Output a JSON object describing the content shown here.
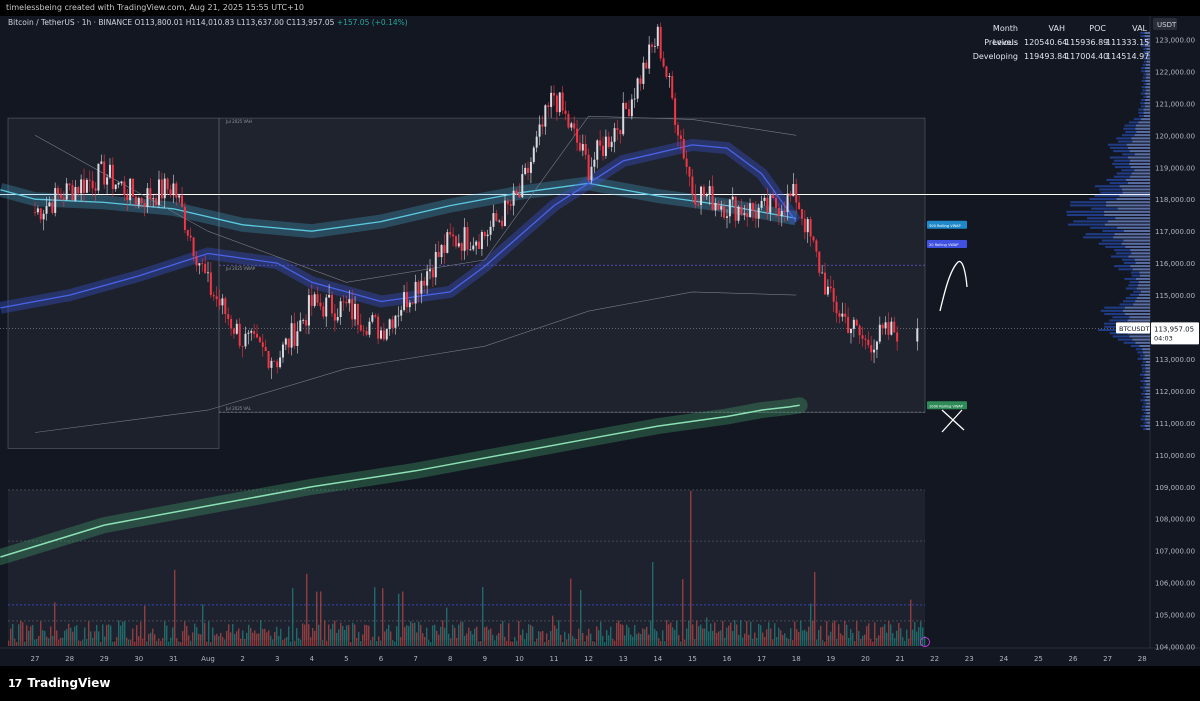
{
  "header": {
    "caption": "timelessbeing created with TradingView.com, Aug 21, 2025 15:55 UTC+10"
  },
  "instrument": {
    "title": "Bitcoin / TetherUS · 1h · BINANCE",
    "open": "O113,800.01",
    "high": "H114,010.83",
    "low": "L113,637.00",
    "close": "C113,957.05",
    "change": "+157.05 (+0.14%)"
  },
  "month_levels": {
    "headers": [
      "Month Levels",
      "VAH",
      "POC",
      "VAL"
    ],
    "rows": [
      [
        "Previous",
        "120540.64",
        "115936.89",
        "111333.15"
      ],
      [
        "Developing",
        "119493.84",
        "117004.40",
        "114514.97"
      ]
    ]
  },
  "price_axis": {
    "currency": "USDT",
    "ticks": [
      "123,000.00",
      "122,000.00",
      "121,000.00",
      "120,000.00",
      "119,000.00",
      "118,000.00",
      "117,000.00",
      "116,000.00",
      "115,000.00",
      "114,000.00",
      "113,000.00",
      "112,000.00",
      "111,000.00",
      "110,000.00",
      "109,000.00",
      "108,000.00",
      "107,000.00",
      "106,000.00",
      "105,000.00",
      "104,000.00"
    ],
    "symbol_tag": "BTCUSDT",
    "last_price": "113,957.05",
    "countdown": "04:03"
  },
  "time_axis": {
    "ticks": [
      "27",
      "28",
      "29",
      "30",
      "31",
      "Aug",
      "2",
      "3",
      "4",
      "5",
      "6",
      "7",
      "8",
      "9",
      "10",
      "11",
      "12",
      "13",
      "14",
      "15",
      "16",
      "17",
      "18",
      "19",
      "20",
      "21",
      "22",
      "23",
      "24",
      "25",
      "26",
      "27",
      "28"
    ]
  },
  "chart_labels": {
    "prev_vah": "Jul 2025 VAH",
    "prev_poc": "Jul 2025 VWAP",
    "prev_val": "Jul 2025 VAL",
    "vwap_500": "500 Rolling VWAP",
    "vwap_20": "20 Rolling VWAP",
    "vwap_1000": "1000 Rolling VWAP"
  },
  "colors": {
    "background": "#131722",
    "candle_up": "#d9dbe0",
    "candle_down": "#f23645",
    "vwap_cyan": "#5cc8e0",
    "vwap_blue": "#4a63e8",
    "vwap_green": "#8be0b4",
    "volume_profile": "#2b5bd9"
  },
  "brand": {
    "name": "TradingView"
  },
  "chart_data": {
    "type": "line",
    "title": "Bitcoin / TetherUS · 1h · BINANCE",
    "xlabel": "",
    "ylabel": "",
    "ylim": [
      104000,
      123000
    ],
    "x": [
      "Jul 27",
      "Jul 28",
      "Jul 29",
      "Jul 30",
      "Jul 31",
      "Aug 1",
      "Aug 2",
      "Aug 3",
      "Aug 4",
      "Aug 5",
      "Aug 6",
      "Aug 7",
      "Aug 8",
      "Aug 9",
      "Aug 10",
      "Aug 11",
      "Aug 12",
      "Aug 13",
      "Aug 14",
      "Aug 15",
      "Aug 16",
      "Aug 17",
      "Aug 18",
      "Aug 19",
      "Aug 20",
      "Aug 21"
    ],
    "series": [
      {
        "values": [
          117600,
          118300,
          118800,
          118000,
          118400,
          115300,
          113600,
          113000,
          114700,
          114600,
          113900,
          115300,
          116700,
          116900,
          118100,
          121300,
          119000,
          120600,
          123100,
          118300,
          117800,
          117600,
          118100,
          114800,
          113500,
          113957
        ]
      }
    ],
    "price_levels": {
      "white_horizontal": 118150,
      "current": 113957
    }
  }
}
